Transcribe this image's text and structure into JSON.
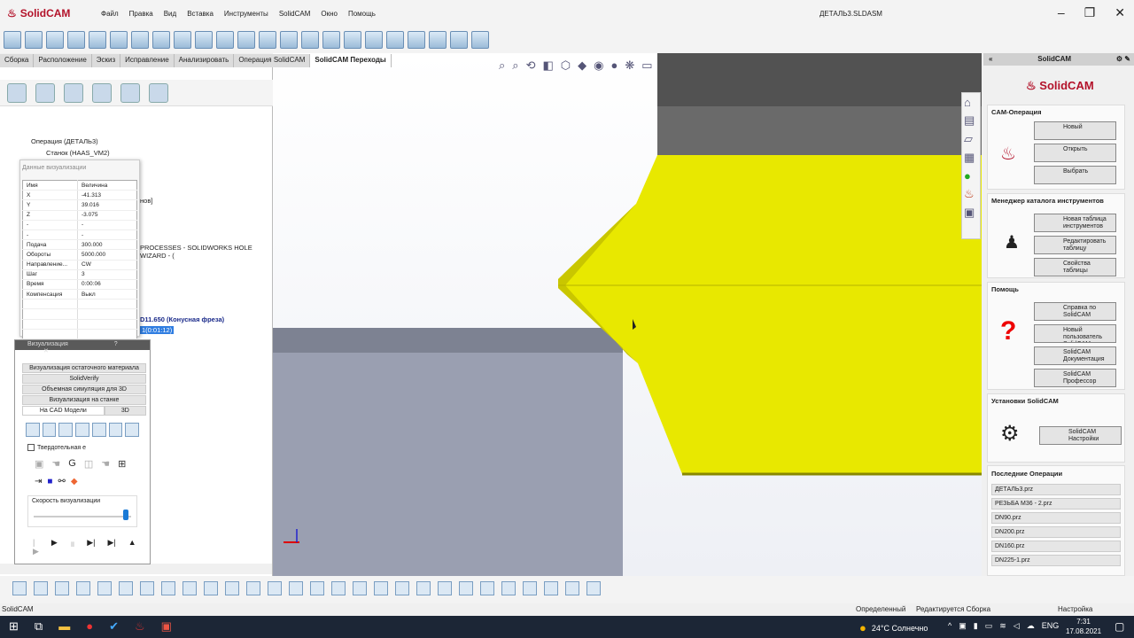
{
  "app": {
    "name": "SolidCAM",
    "window_title": "ДЕТАЛЬ3.SLDASM"
  },
  "menu": [
    "Файл",
    "Правка",
    "Вид",
    "Вставка",
    "Инструменты",
    "SolidCAM",
    "Окно",
    "Помощь"
  ],
  "tabs": [
    "Сборка",
    "Расположение",
    "Эскиз",
    "Исправление",
    "Анализировать",
    "Операция SolidCAM",
    "SolidCAM Переходы"
  ],
  "tree": {
    "root": "Операция (ДЕТАЛЬ3)",
    "machine": "Станок (HAAS_VM2)",
    "partial1": "нов]",
    "partial2": "PROCESSES - SOLIDWORKS HOLE WIZARD - (",
    "tool": "D11.650  (Конусная фреза)",
    "time": "1(0:01:12)"
  },
  "vis_data": {
    "title": "Данные визуализации",
    "col_name": "Имя",
    "col_value": "Величина",
    "rows": [
      [
        "X",
        "-41.313"
      ],
      [
        "Y",
        "39.016"
      ],
      [
        "Z",
        "-3.075"
      ],
      [
        "-",
        "-"
      ],
      [
        "-",
        "-"
      ],
      [
        "Подача",
        "300.000"
      ],
      [
        "Обороты",
        "5000.000"
      ],
      [
        "Направление...",
        "CW"
      ],
      [
        "Шаг",
        "3"
      ],
      [
        "Время",
        "0:00:06"
      ],
      [
        "Компенсация",
        "Выкл"
      ]
    ]
  },
  "vis_panel": {
    "title": "Визуализация",
    "help": "?",
    "buttons": [
      "Визуализация остаточного материала",
      "SolidVerify",
      "Объемная симуляция для 3D",
      "Визуализация на станке"
    ],
    "tab_cad": "На  CAD Модели",
    "tab_3d": "3D",
    "solid_checkbox": "Твердотельная е",
    "speed_label": "Скорость визуализации",
    "speed": 0.95
  },
  "right": {
    "header": "SolidCAM",
    "logo": "SolidCAM",
    "cam_ops": {
      "title": "CAM-Операция",
      "new": "Новый",
      "open": "Открыть",
      "select": "Выбрать"
    },
    "tools": {
      "title": "Менеджер каталога инструментов",
      "new_table": "Новая таблица инструментов",
      "edit_table": "Редактировать таблицу инструментов",
      "table_props": "Свойства таблицы инструментов"
    },
    "help": {
      "title": "Помощь",
      "help_btn": "Справка по SolidCAM",
      "new_user": "Новый пользователь SolidCAM",
      "docs": "SolidCAM Документация",
      "prof": "SolidCAM Профессор"
    },
    "settings": {
      "title": "Установки SolidCAM",
      "btn": "SolidCAM Настройки"
    },
    "recent": {
      "title": "Последние Операции",
      "items": [
        "ДЕТАЛЬ3.prz",
        "РЕЗЬБА М36 - 2.prz",
        "DN90.prz",
        "DN200.prz",
        "DN160.prz",
        "DN225-1.prz"
      ]
    }
  },
  "status": {
    "left": "SolidCAM",
    "defined": "Определенный",
    "editing": "Редактируется Сборка",
    "settings": "Настройка"
  },
  "taskbar": {
    "weather": "24°C  Солнечно",
    "lang": "ENG",
    "time": "7:31",
    "date": "17.08.2021"
  }
}
